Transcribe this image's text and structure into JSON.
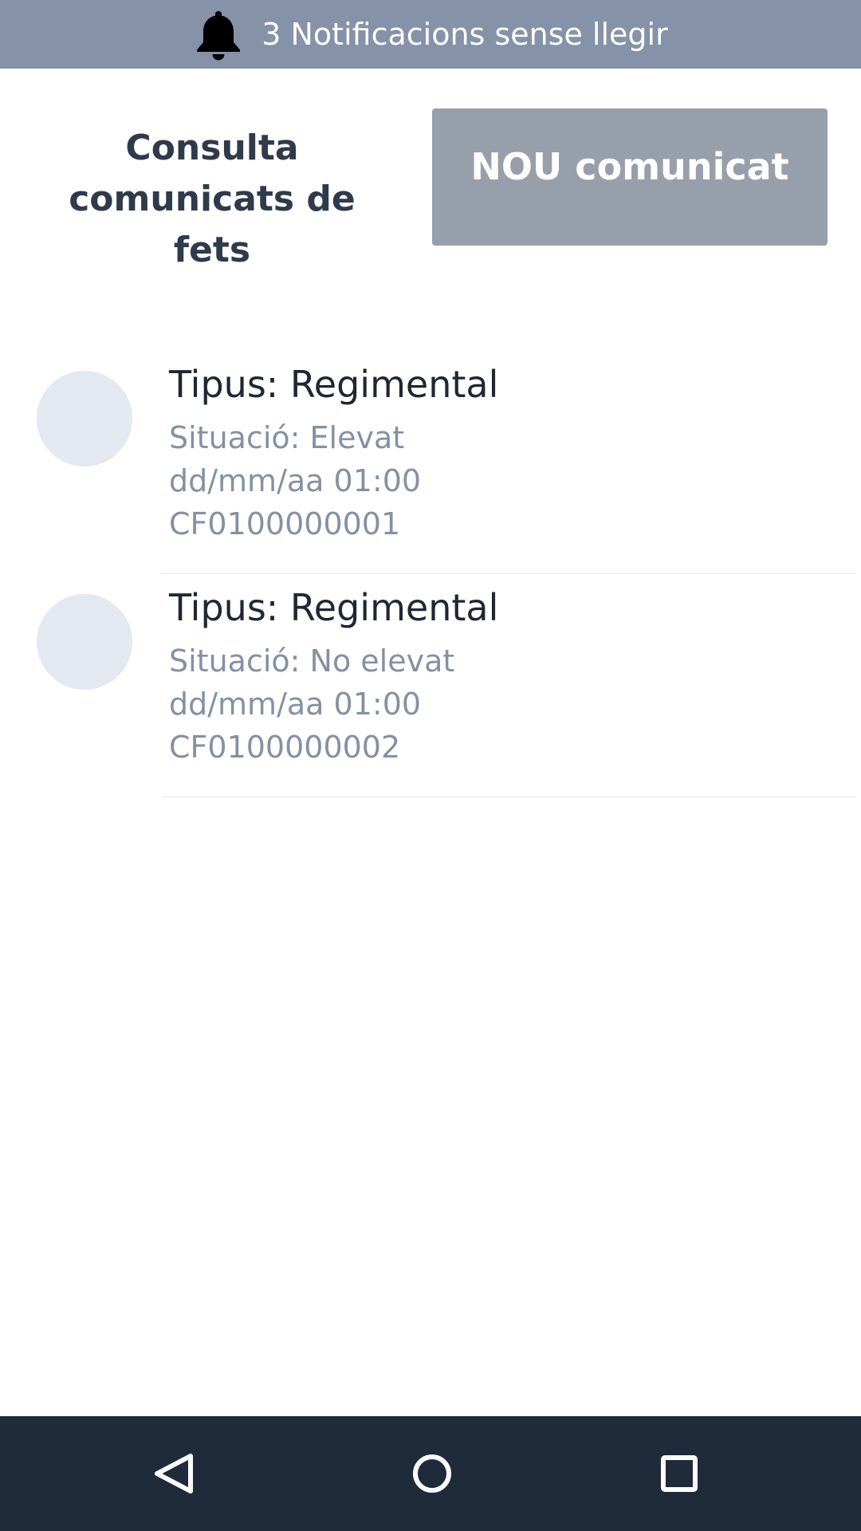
{
  "notification": {
    "icon": "bell-icon",
    "text": "3 Notificacions sense llegir"
  },
  "header": {
    "title_line1": "Consulta",
    "title_line2": "comunicats de fets",
    "new_button_label": "NOU comunicat"
  },
  "list": {
    "items": [
      {
        "title": "Tipus: Regimental",
        "situacio": "Situació: Elevat",
        "date": "dd/mm/aa 01:00",
        "code": "CF0100000001"
      },
      {
        "title": "Tipus: Regimental",
        "situacio": "Situació: No elevat",
        "date": "dd/mm/aa 01:00",
        "code": "CF0100000002"
      }
    ]
  },
  "nav": {
    "back_icon": "back-triangle-icon",
    "home_icon": "home-circle-icon",
    "recent_icon": "recent-square-icon"
  },
  "colors": {
    "banner": "#8592a8",
    "button": "#979fab",
    "title_text": "#2f3a4b",
    "secondary_text": "#8491a3",
    "avatar": "#e4e8f0",
    "nav_bar": "#1f2b3b"
  }
}
